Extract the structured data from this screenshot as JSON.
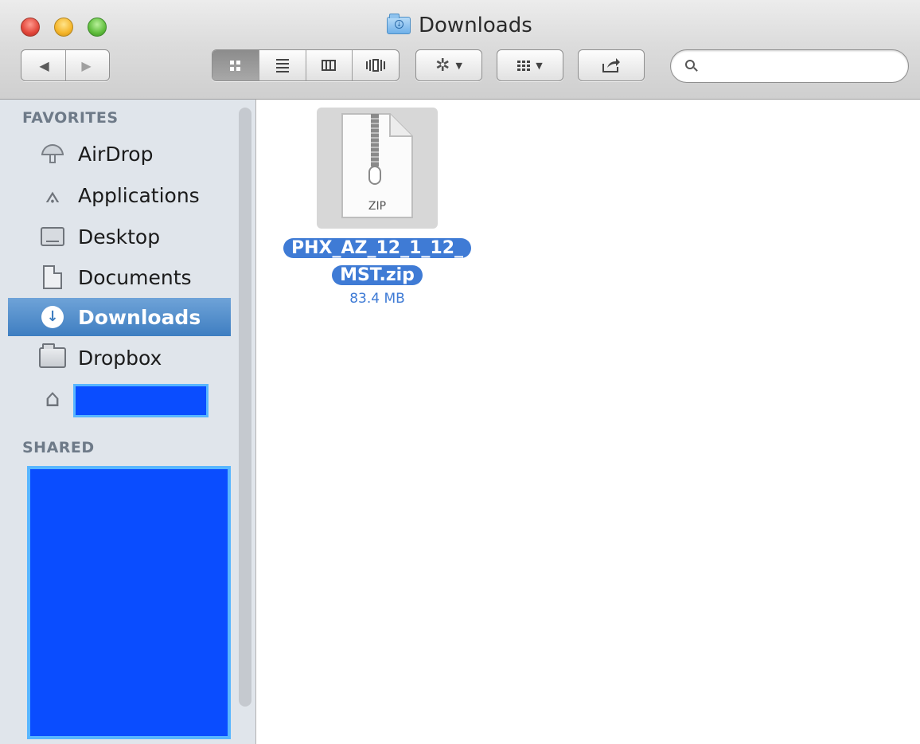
{
  "window": {
    "title": "Downloads"
  },
  "toolbar": {
    "nav_back": "◀",
    "nav_forward": "▶",
    "search_placeholder": ""
  },
  "sidebar": {
    "favorites_heading": "FAVORITES",
    "shared_heading": "SHARED",
    "items": [
      {
        "label": "AirDrop",
        "icon": "airdrop-icon"
      },
      {
        "label": "Applications",
        "icon": "applications-icon"
      },
      {
        "label": "Desktop",
        "icon": "desktop-icon"
      },
      {
        "label": "Documents",
        "icon": "documents-icon"
      },
      {
        "label": "Downloads",
        "icon": "downloads-icon",
        "selected": true
      },
      {
        "label": "Dropbox",
        "icon": "folder-icon"
      },
      {
        "label": "",
        "icon": "home-icon"
      }
    ]
  },
  "files": [
    {
      "name_line1": "PHX_AZ_12_1_12_",
      "name_line2": "MST.zip",
      "size": "83.4 MB",
      "badge": "ZIP"
    }
  ],
  "colors": {
    "selection": "#3e7ec1",
    "redaction": "#0a4dff"
  }
}
